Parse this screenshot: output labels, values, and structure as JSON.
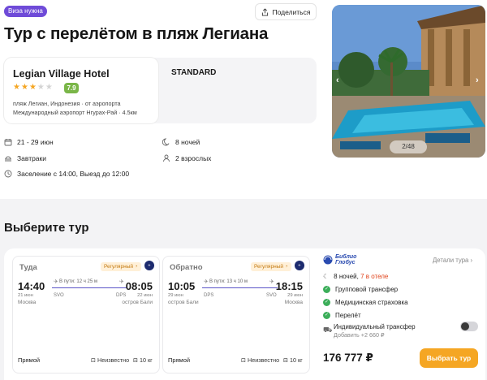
{
  "badge": "Виза нужна",
  "share_label": "Поделиться",
  "title": "Тур с перелётом в пляж Легиана",
  "hotel": {
    "name": "Legian Village Hotel",
    "stars": 3,
    "stars_total": 5,
    "rating": "7.9",
    "location": "пляж Легиан, Индонезия",
    "airport_distance": "от аэропорта",
    "airport": "Международный аэропорт Нгурах-Рай · 4.5км",
    "room_type": "STANDARD"
  },
  "info": {
    "dates": "21 - 29 июн",
    "nights": "8 ночей",
    "meal": "Завтраки",
    "guests": "2 взрослых",
    "checkin": "Заселение с 14:00, Выезд до 12:00"
  },
  "gallery": {
    "counter": "2/48"
  },
  "section_title": "Выберите тур",
  "flights": [
    {
      "direction": "Туда",
      "badge": "Регулярный",
      "dep_time": "14:40",
      "arr_time": "08:05",
      "duration": "В пути: 12 ч 25 м",
      "dep_date": "21 июн",
      "arr_date": "22 июн",
      "dep_code": "SVO",
      "arr_code": "DPS",
      "dep_city": "Москва",
      "arr_city": "остров Бали",
      "stops": "Прямой",
      "carry_on": "Неизвестно",
      "baggage": "10 кг"
    },
    {
      "direction": "Обратно",
      "badge": "Регулярный",
      "dep_time": "10:05",
      "arr_time": "18:15",
      "duration": "В пути: 13 ч 10 м",
      "dep_date": "29 июн",
      "arr_date": "29 июн",
      "dep_code": "DPS",
      "arr_code": "SVO",
      "dep_city": "остров Бали",
      "arr_city": "Москва",
      "stops": "Прямой",
      "carry_on": "Неизвестно",
      "baggage": "10 кг"
    }
  ],
  "tour": {
    "operator": "Библио Глобус",
    "details": "Детали тура",
    "nights_text": "8 ночей,",
    "nights_hotel": "7 в отеле",
    "services": [
      "Групповой трансфер",
      "Медицинская страховка",
      "Перелёт"
    ],
    "transfer_label": "Индивидуальный трансфер",
    "transfer_add": "Добавить +2 660 ₽",
    "price": "176 777 ₽",
    "choose": "Выбрать тур"
  },
  "colors": {
    "accent": "#f5a623",
    "badge": "#6f4bd8",
    "rating": "#7ab648",
    "check": "#3cae5a",
    "red": "#e0421a"
  }
}
